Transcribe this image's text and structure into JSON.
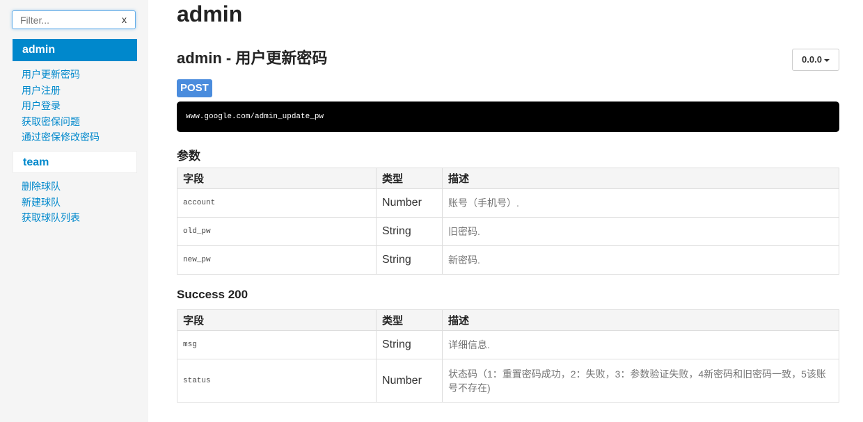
{
  "sidebar": {
    "filter_placeholder": "Filter...",
    "filter_clear": "x",
    "groups": [
      {
        "title": "admin",
        "items": [
          "用户更新密码",
          "用户注册",
          "用户登录",
          "获取密保问题",
          "通过密保修改密码"
        ]
      },
      {
        "title": "team",
        "items": [
          "删除球队",
          "新建球队",
          "获取球队列表"
        ]
      }
    ]
  },
  "main": {
    "page_title": "admin",
    "section_title": "admin - 用户更新密码",
    "version": "0.0.0",
    "method": "POST",
    "url": "www.google.com/admin_update_pw",
    "params_title": "参数",
    "success_title": "Success 200",
    "headers": [
      "字段",
      "类型",
      "描述"
    ],
    "params": [
      {
        "field": "account",
        "type": "Number",
        "desc": "账号（手机号）."
      },
      {
        "field": "old_pw",
        "type": "String",
        "desc": "旧密码."
      },
      {
        "field": "new_pw",
        "type": "String",
        "desc": "新密码."
      }
    ],
    "success": [
      {
        "field": "msg",
        "type": "String",
        "desc": "详细信息."
      },
      {
        "field": "status",
        "type": "Number",
        "desc": "状态码（1：重置密码成功，2：失败，3：参数验证失败，4新密码和旧密码一致，5该账号不存在)"
      }
    ]
  },
  "colors": {
    "accent": "#0088cc",
    "method_badge": "#4a8cdd",
    "url_bg": "#000000"
  }
}
